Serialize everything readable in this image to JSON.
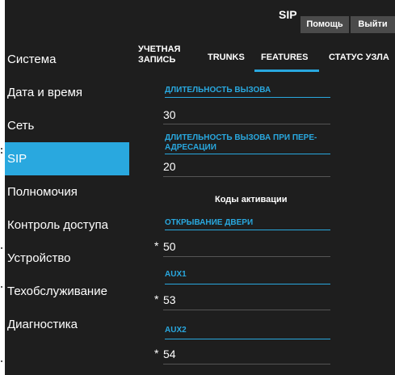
{
  "header": {
    "title": "SIP",
    "help_label": "Помощь",
    "logout_label": "Выйти"
  },
  "sidebar": {
    "items": [
      {
        "label": "Система"
      },
      {
        "label": "Дата и время"
      },
      {
        "label": "Сеть"
      },
      {
        "label": "SIP",
        "active": true
      },
      {
        "label": "Полномочия"
      },
      {
        "label": "Контроль доступа"
      },
      {
        "label": "Устройство"
      },
      {
        "label": "Техобслуживание"
      },
      {
        "label": "Диагностика"
      }
    ]
  },
  "tabs": {
    "account_line1": "УЧЕТНАЯ",
    "account_line2": "ЗАПИСЬ",
    "trunks": "TRUNKS",
    "features": "FEATURES",
    "node_status": "СТАТУС УЗЛА",
    "active_tab": "FEATURES"
  },
  "form": {
    "call_duration": {
      "label": "ДЛИТЕЛЬНОСТЬ ВЫЗОВА",
      "value": "30"
    },
    "forward_duration": {
      "label_line1": "ДЛИТЕЛЬНОСТЬ ВЫЗОВА ПРИ ПЕРЕ-",
      "label_line2": "АДРЕСАЦИИ",
      "value": "20"
    },
    "activation_codes_heading": "Коды активации",
    "door_open": {
      "label": "ОТКРЫВАНИЕ ДВЕРИ",
      "value": "50",
      "required_mark": "*"
    },
    "aux1": {
      "label": "AUX1",
      "value": "53",
      "required_mark": "*"
    },
    "aux2": {
      "label": "AUX2",
      "value": "54",
      "required_mark": "*"
    }
  },
  "colors": {
    "accent": "#29a8df",
    "background": "#1e1e1e",
    "button": "#4b4b4b"
  }
}
